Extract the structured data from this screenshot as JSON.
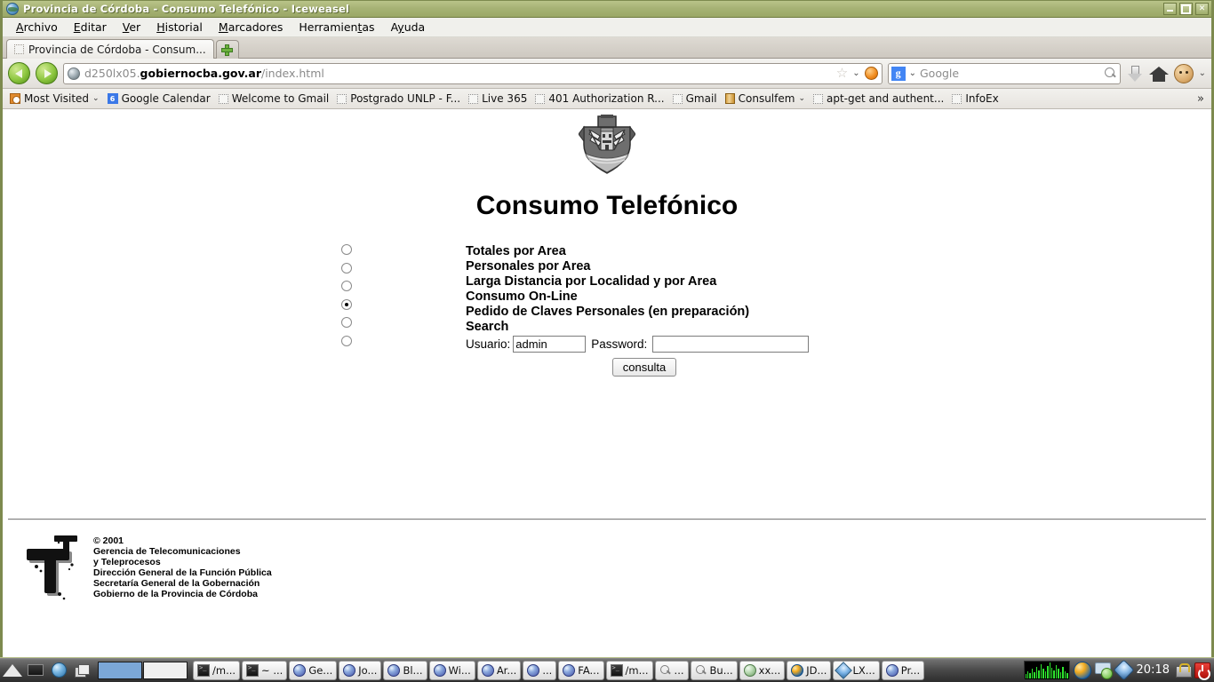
{
  "window": {
    "title": "Provincia de Córdoba - Consumo Telefónico - Iceweasel",
    "icon": "globe-icon",
    "buttons": {
      "minimize": "minimize-button",
      "maximize": "maximize-button",
      "close": "close-button"
    }
  },
  "menubar": {
    "items": [
      {
        "label": "Archivo"
      },
      {
        "label": "Editar"
      },
      {
        "label": "Ver"
      },
      {
        "label": "Historial"
      },
      {
        "label": "Marcadores"
      },
      {
        "label": "Herramientas"
      },
      {
        "label": "Ayuda"
      }
    ]
  },
  "tabs": {
    "items": [
      {
        "label": "Provincia de Córdoba - Consum..."
      }
    ],
    "new_tab_label": "+"
  },
  "navbar": {
    "back_label": "Atrás",
    "forward_label": "Adelante",
    "url_prefix": "d250lx05.",
    "url_domain": "gobiernocba.gov.ar",
    "url_path": "/index.html",
    "url_full": "d250lx05.gobiernocba.gov.ar/index.html",
    "star_glyph": "☆",
    "chevron_glyph": "⌄",
    "search_engine": "g-icon",
    "search_placeholder": "Google",
    "search_value": ""
  },
  "bookmarks": {
    "items": [
      {
        "label": "Most Visited",
        "icon": "most-visited-icon",
        "dropdown": true
      },
      {
        "label": "Google Calendar",
        "icon": "calendar-icon",
        "dropdown": false
      },
      {
        "label": "Welcome to Gmail",
        "icon": "dotted-icon",
        "dropdown": false
      },
      {
        "label": "Postgrado UNLP - F...",
        "icon": "dotted-icon",
        "dropdown": false
      },
      {
        "label": "Live 365",
        "icon": "dotted-icon",
        "dropdown": false
      },
      {
        "label": "401 Authorization R...",
        "icon": "dotted-icon",
        "dropdown": false
      },
      {
        "label": "Gmail",
        "icon": "dotted-icon",
        "dropdown": false
      },
      {
        "label": "Consulfem",
        "icon": "book-icon",
        "dropdown": true
      },
      {
        "label": "apt-get and authent...",
        "icon": "dotted-icon",
        "dropdown": false
      },
      {
        "label": "InfoEx",
        "icon": "dotted-icon",
        "dropdown": false
      }
    ],
    "overflow_glyph": "»"
  },
  "page": {
    "crest_alt": "Escudo de la Provincia de Córdoba",
    "title": "Consumo Telefónico",
    "options": [
      {
        "label": "Totales por Area",
        "selected": false
      },
      {
        "label": "Personales por Area",
        "selected": false
      },
      {
        "label": "Larga Distancia por Localidad y por Area",
        "selected": false
      },
      {
        "label": "Consumo On-Line",
        "selected": true
      },
      {
        "label": "Pedido de Claves Personales (en preparación)",
        "selected": false
      },
      {
        "label": "Search",
        "selected": false
      }
    ],
    "form": {
      "usuario_label": "Usuario:",
      "usuario_value": "admin",
      "password_label": "Password:",
      "password_value": "",
      "submit_label": "consulta"
    },
    "footer": {
      "copyright": "© 2001",
      "lines": [
        "Gerencia de Telecomunicaciones",
        "y Teleprocesos",
        "Dirección General de la Función Pública",
        "Secretaría General de la Gobernación",
        "Gobierno de la Provincia de Córdoba"
      ]
    }
  },
  "taskbar": {
    "launchers": [
      {
        "name": "menu-icon"
      },
      {
        "name": "terminal-icon"
      },
      {
        "name": "browser-icon"
      },
      {
        "name": "window-list-icon"
      }
    ],
    "pager": [
      {
        "active": true
      },
      {
        "active": false
      }
    ],
    "windows": [
      {
        "label": "/m...",
        "icon": "terminal-icon"
      },
      {
        "label": "~ ...",
        "icon": "terminal-icon"
      },
      {
        "label": "Ge...",
        "icon": "iceweasel-icon"
      },
      {
        "label": "Jo...",
        "icon": "iceweasel-icon"
      },
      {
        "label": "Bl...",
        "icon": "iceweasel-icon"
      },
      {
        "label": "Wi...",
        "icon": "iceweasel-icon"
      },
      {
        "label": "Ar...",
        "icon": "iceweasel-icon"
      },
      {
        "label": "...",
        "icon": "iceweasel-icon"
      },
      {
        "label": "FA...",
        "icon": "iceweasel-icon"
      },
      {
        "label": "/m...",
        "icon": "terminal-icon"
      },
      {
        "label": "...",
        "icon": "magnifier-icon"
      },
      {
        "label": "Bu...",
        "icon": "magnifier-icon"
      },
      {
        "label": "xx...",
        "icon": "green-globe-icon"
      },
      {
        "label": "JD...",
        "icon": "jdownloader-icon"
      },
      {
        "label": "LX...",
        "icon": "lx-icon"
      },
      {
        "label": "Pr...",
        "icon": "iceweasel-icon"
      }
    ],
    "tray": {
      "cpu_bars": [
        4,
        7,
        5,
        9,
        6,
        11,
        8,
        14,
        9,
        7,
        12,
        16,
        10,
        8,
        13,
        9,
        6,
        11,
        7,
        5
      ],
      "icons": [
        {
          "name": "jdownloader-tray-icon"
        },
        {
          "name": "chat-tray-icon"
        },
        {
          "name": "network-tray-icon"
        }
      ],
      "clock": "20:18",
      "lock_icon": "lock-icon",
      "power_icon": "power-icon"
    }
  },
  "colors": {
    "titlebar": "#a7b375",
    "titlebar_border": "#7d8a4e",
    "accent_green": "#8cc63f",
    "taskbar": "#484848",
    "cpu_green": "#2ee62e"
  }
}
